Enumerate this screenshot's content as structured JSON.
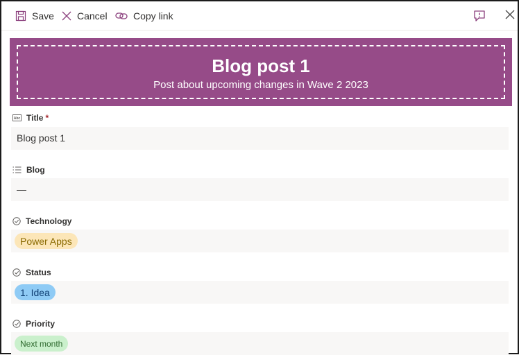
{
  "toolbar": {
    "save_label": "Save",
    "cancel_label": "Cancel",
    "copy_link_label": "Copy link"
  },
  "banner": {
    "title": "Blog post 1",
    "subtitle": "Post about upcoming changes in Wave 2 2023",
    "background_color": "#964b88"
  },
  "fields": {
    "title": {
      "label": "Title",
      "required_mark": "*",
      "value": "Blog post 1",
      "icon": "text-field-icon"
    },
    "blog": {
      "label": "Blog",
      "value": "—",
      "icon": "multiline-text-icon"
    },
    "technology": {
      "label": "Technology",
      "value": "Power Apps",
      "icon": "choice-icon",
      "pill_bg": "#fce6b8",
      "pill_fg": "#8a6a00"
    },
    "status": {
      "label": "Status",
      "value": "1. Idea",
      "icon": "choice-icon",
      "pill_bg": "#8fcbf5",
      "pill_fg": "#0f3f73"
    },
    "priority": {
      "label": "Priority",
      "value": "Next month",
      "icon": "choice-icon",
      "pill_bg": "#caf0cc",
      "pill_fg": "#2f6a2f"
    }
  }
}
